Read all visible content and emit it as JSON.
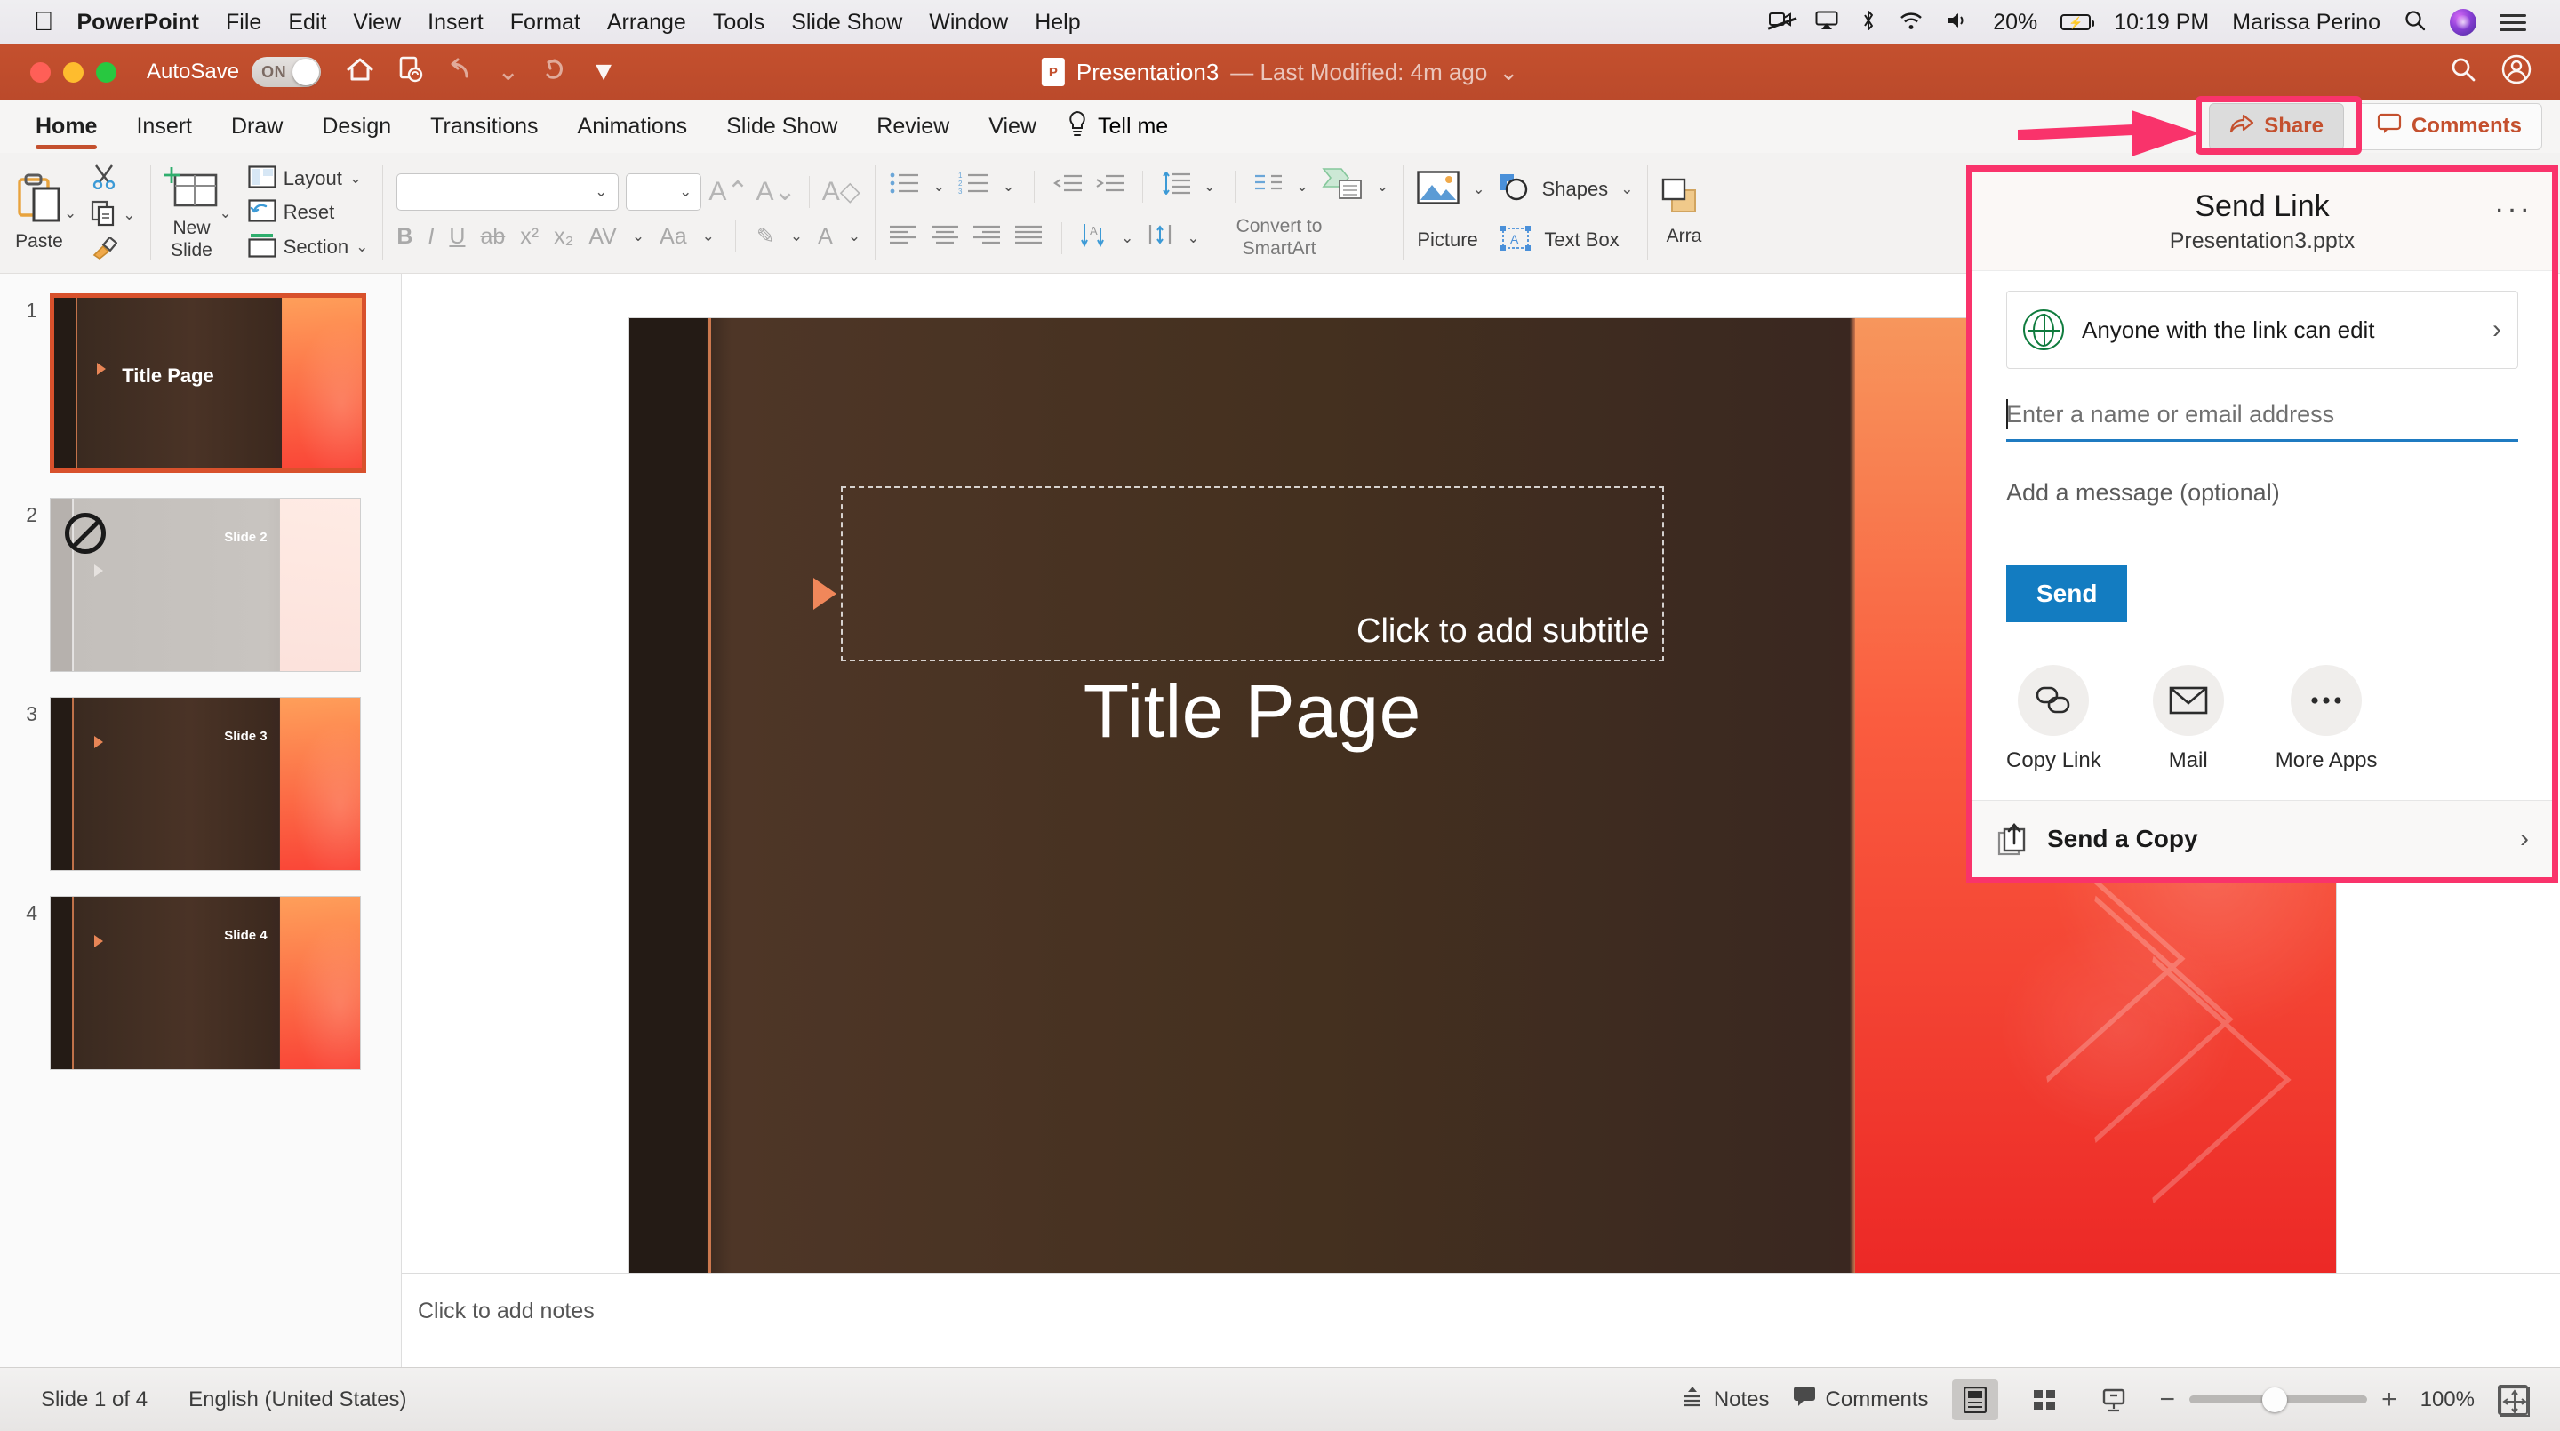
{
  "macbar": {
    "apple_icon": "apple-logo-icon",
    "app_name": "PowerPoint",
    "menus": [
      "File",
      "Edit",
      "View",
      "Insert",
      "Format",
      "Arrange",
      "Tools",
      "Slide Show",
      "Window",
      "Help"
    ],
    "status": {
      "battery_percent": "20%",
      "time": "10:19 PM",
      "user": "Marissa Perino"
    }
  },
  "titlebar": {
    "autosave_label": "AutoSave",
    "autosave_state": "ON",
    "doc_name": "Presentation3",
    "doc_status": "— Last Modified: 4m ago"
  },
  "ribbon_tabs": {
    "tabs": [
      "Home",
      "Insert",
      "Draw",
      "Design",
      "Transitions",
      "Animations",
      "Slide Show",
      "Review",
      "View"
    ],
    "active": "Home",
    "tell_me": "Tell me",
    "share_label": "Share",
    "comments_label": "Comments"
  },
  "ribbon": {
    "paste_label": "Paste",
    "new_slide_label_1": "New",
    "new_slide_label_2": "Slide",
    "layout_label": "Layout",
    "reset_label": "Reset",
    "section_label": "Section",
    "font_value": "",
    "font_size_value": "",
    "convert_smartart_1": "Convert to",
    "convert_smartart_2": "SmartArt",
    "picture_label": "Picture",
    "shapes_label": "Shapes",
    "textbox_label": "Text Box",
    "arrange_label": "Arra"
  },
  "slides": [
    {
      "num": "1",
      "title": "Title Page",
      "label": "",
      "selected": true,
      "gray": false,
      "blocked": false
    },
    {
      "num": "2",
      "title": "",
      "label": "Slide 2",
      "selected": false,
      "gray": true,
      "blocked": true
    },
    {
      "num": "3",
      "title": "",
      "label": "Slide 3",
      "selected": false,
      "gray": false,
      "blocked": false
    },
    {
      "num": "4",
      "title": "",
      "label": "Slide 4",
      "selected": false,
      "gray": false,
      "blocked": false
    }
  ],
  "canvas": {
    "subtitle_placeholder": "Click to add subtitle",
    "title_text": "Title Page",
    "notes_placeholder": "Click to add notes"
  },
  "send_link": {
    "title": "Send Link",
    "filename": "Presentation3.pptx",
    "more_options": "···",
    "permission_text": "Anyone with the link can edit",
    "email_placeholder": "Enter a name or email address",
    "message_placeholder": "Add a message (optional)",
    "send_button": "Send",
    "apps": [
      {
        "label": "Copy Link",
        "icon": "link-icon"
      },
      {
        "label": "Mail",
        "icon": "envelope-icon"
      },
      {
        "label": "More Apps",
        "icon": "ellipsis-icon"
      }
    ],
    "send_copy_label": "Send a Copy"
  },
  "statusbar": {
    "slide_count": "Slide 1 of 4",
    "language": "English (United States)",
    "notes_label": "Notes",
    "comments_label": "Comments",
    "zoom_level": "100%"
  },
  "colors": {
    "brand_orange": "#c4502e",
    "annotation_pink": "#f9336b",
    "send_blue": "#137cc1",
    "permission_green": "#0f7b3d"
  }
}
